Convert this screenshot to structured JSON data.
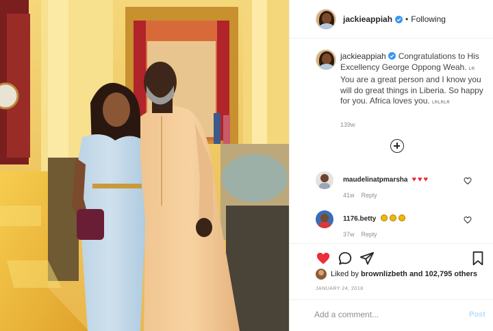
{
  "post": {
    "username": "jackieappiah",
    "follow_status": "Following",
    "separator": "•",
    "caption_text": "Congratulations to His Excellency George Oppong Weah. ",
    "caption_small_1": "LR",
    "caption_text_2": " You are a great person and I know you will do great things in Liberia. So happy for you. Africa loves you. ",
    "caption_small_2": "LRLRLR",
    "caption_time": "139w"
  },
  "comments": [
    {
      "username": "maudelinatpmarsha",
      "time": "41w",
      "reply_label": "Reply"
    },
    {
      "username": "1176.betty",
      "time": "37w",
      "reply_label": "Reply"
    }
  ],
  "likes": {
    "prefix": "Liked by",
    "user": "brownlizbeth",
    "rest": "and 102,795 others"
  },
  "date": "JANUARY 24, 2018",
  "add_comment": {
    "placeholder": "Add a comment...",
    "post_label": "Post"
  },
  "icons": {
    "verified": "verified-badge-icon",
    "like": "heart-icon",
    "comment": "comment-bubble-icon",
    "share": "paper-plane-icon",
    "save": "bookmark-icon",
    "more": "plus-circle-icon",
    "comment_like": "heart-outline-icon"
  },
  "colors": {
    "like_active": "#ed2d3a",
    "verified": "#3897f0",
    "post_disabled": "#b2dffc",
    "muted": "#8e8e8e"
  }
}
